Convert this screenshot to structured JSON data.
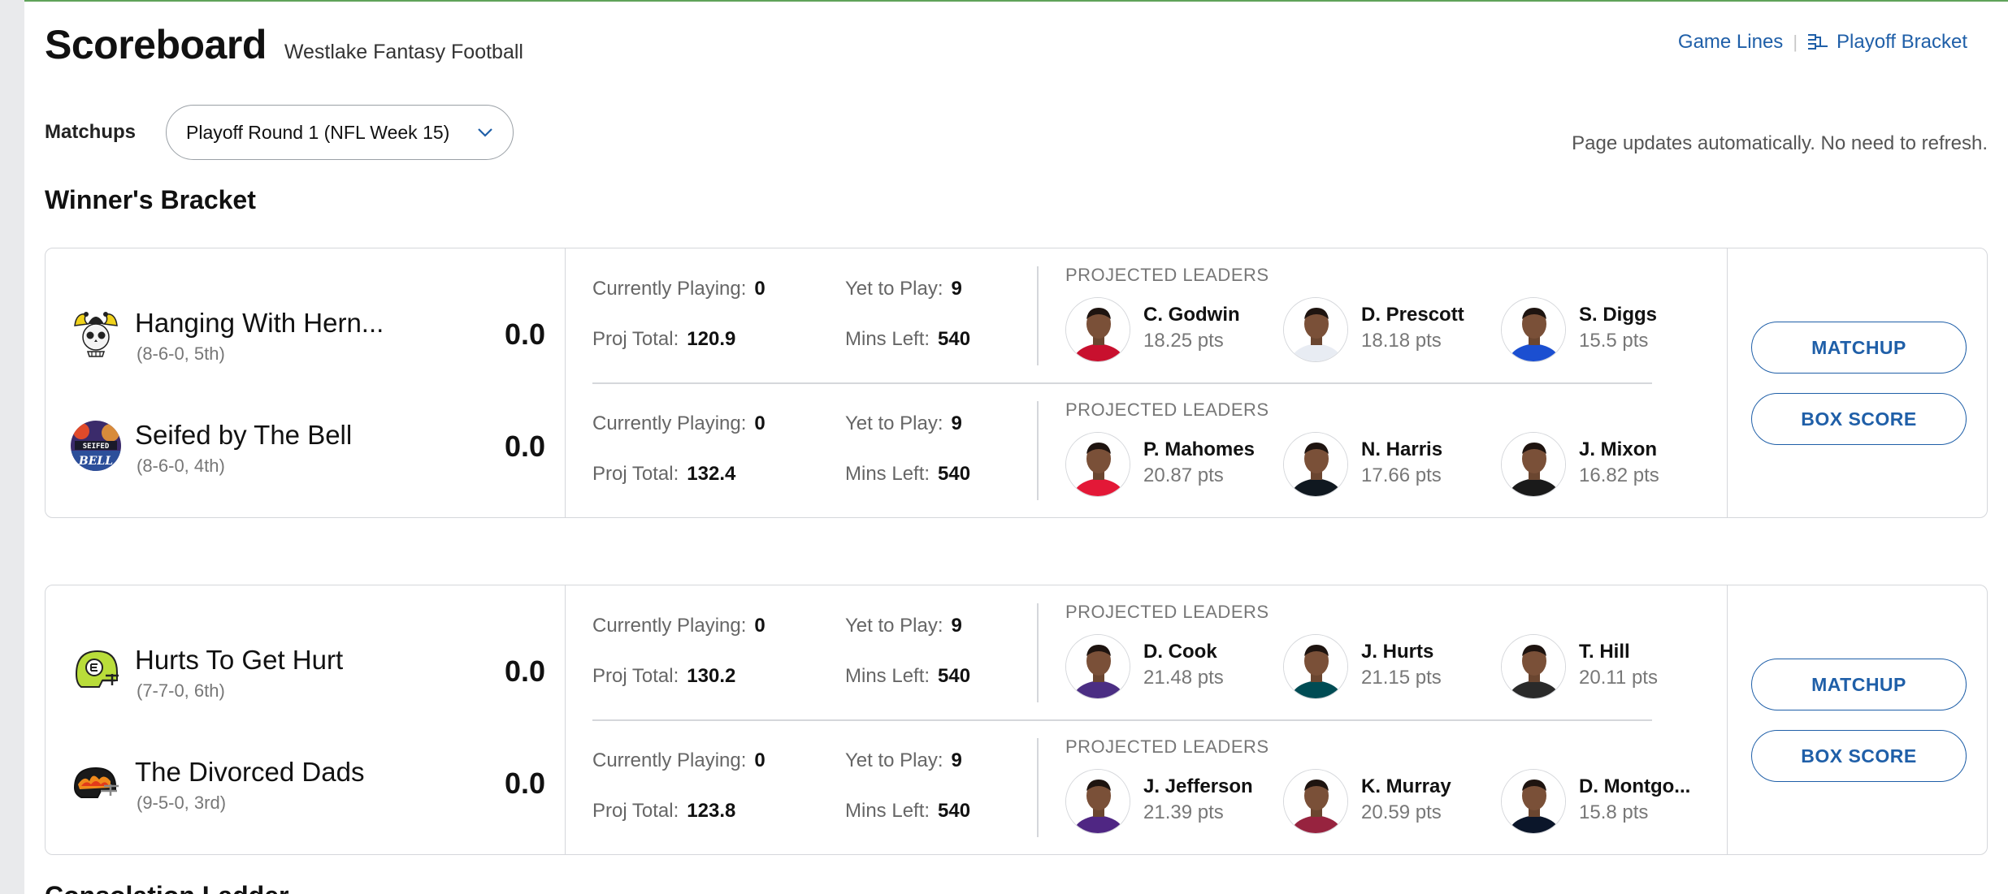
{
  "header": {
    "title": "Scoreboard",
    "league_name": "Westlake Fantasy Football",
    "game_lines": "Game Lines",
    "separator": "|",
    "playoff_bracket": "Playoff Bracket"
  },
  "filters": {
    "matchups_label": "Matchups",
    "selected_period": "Playoff Round 1 (NFL Week 15)"
  },
  "auto_update_note": "Page updates automatically. No need to refresh.",
  "section_title": "Winner's Bracket",
  "next_section_title": "Consolation Ladder",
  "labels": {
    "currently_playing": "Currently Playing:",
    "yet_to_play": "Yet to Play:",
    "proj_total": "Proj Total:",
    "mins_left": "Mins Left:",
    "projected_leaders": "PROJECTED LEADERS",
    "matchup_button": "MATCHUP",
    "box_score_button": "BOX SCORE"
  },
  "matchups": [
    {
      "teams": [
        {
          "name": "Hanging With Hern...",
          "record": "(8-6-0, 5th)",
          "score": "0.0",
          "currently_playing": "0",
          "yet_to_play": "9",
          "proj_total": "120.9",
          "mins_left": "540",
          "leaders": [
            {
              "name": "C. Godwin",
              "pts": "18.25 pts",
              "jersey_color": "#c8102e"
            },
            {
              "name": "D. Prescott",
              "pts": "18.18 pts",
              "jersey_color": "#e8ecf3"
            },
            {
              "name": "S. Diggs",
              "pts": "15.5 pts",
              "jersey_color": "#1b4fd1"
            }
          ]
        },
        {
          "name": "Seifed by The Bell",
          "record": "(8-6-0, 4th)",
          "score": "0.0",
          "currently_playing": "0",
          "yet_to_play": "9",
          "proj_total": "132.4",
          "mins_left": "540",
          "leaders": [
            {
              "name": "P. Mahomes",
              "pts": "20.87 pts",
              "jersey_color": "#e31837"
            },
            {
              "name": "N. Harris",
              "pts": "17.66 pts",
              "jersey_color": "#101820"
            },
            {
              "name": "J. Mixon",
              "pts": "16.82 pts",
              "jersey_color": "#1a1a1a"
            }
          ]
        }
      ]
    },
    {
      "teams": [
        {
          "name": "Hurts To Get Hurt",
          "record": "(7-7-0, 6th)",
          "score": "0.0",
          "currently_playing": "0",
          "yet_to_play": "9",
          "proj_total": "130.2",
          "mins_left": "540",
          "leaders": [
            {
              "name": "D. Cook",
              "pts": "21.48 pts",
              "jersey_color": "#4b2e83"
            },
            {
              "name": "J. Hurts",
              "pts": "21.15 pts",
              "jersey_color": "#004c54"
            },
            {
              "name": "T. Hill",
              "pts": "20.11 pts",
              "jersey_color": "#2a2a2a"
            }
          ]
        },
        {
          "name": "The Divorced Dads",
          "record": "(9-5-0, 3rd)",
          "score": "0.0",
          "currently_playing": "0",
          "yet_to_play": "9",
          "proj_total": "123.8",
          "mins_left": "540",
          "leaders": [
            {
              "name": "J. Jefferson",
              "pts": "21.39 pts",
              "jersey_color": "#4f2683"
            },
            {
              "name": "K. Murray",
              "pts": "20.59 pts",
              "jersey_color": "#97233f"
            },
            {
              "name": "D. Montgo...",
              "pts": "15.8 pts",
              "jersey_color": "#0b162a"
            }
          ]
        }
      ]
    }
  ],
  "colors": {
    "link_blue": "#1f5fa8",
    "border": "#d5d7db",
    "muted_text": "#777777"
  }
}
